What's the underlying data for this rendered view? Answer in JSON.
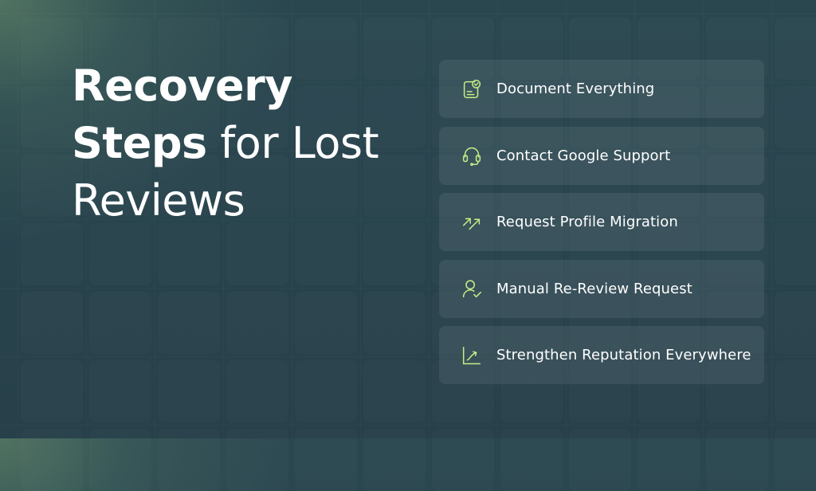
{
  "headline": {
    "bold_part": "Recovery Steps",
    "regular_part": " for Lost Reviews"
  },
  "steps": [
    {
      "label": "Document Everything",
      "icon": "document-check-icon"
    },
    {
      "label": "Contact Google Support",
      "icon": "headset-icon"
    },
    {
      "label": "Request Profile Migration",
      "icon": "transfer-arrows-icon"
    },
    {
      "label": "Manual Re-Review Request",
      "icon": "user-check-icon"
    },
    {
      "label": "Strengthen Reputation Everywhere",
      "icon": "growth-chart-icon"
    }
  ],
  "colors": {
    "background": "#28404a",
    "accent": "#c7ee86",
    "text": "#ffffff"
  }
}
